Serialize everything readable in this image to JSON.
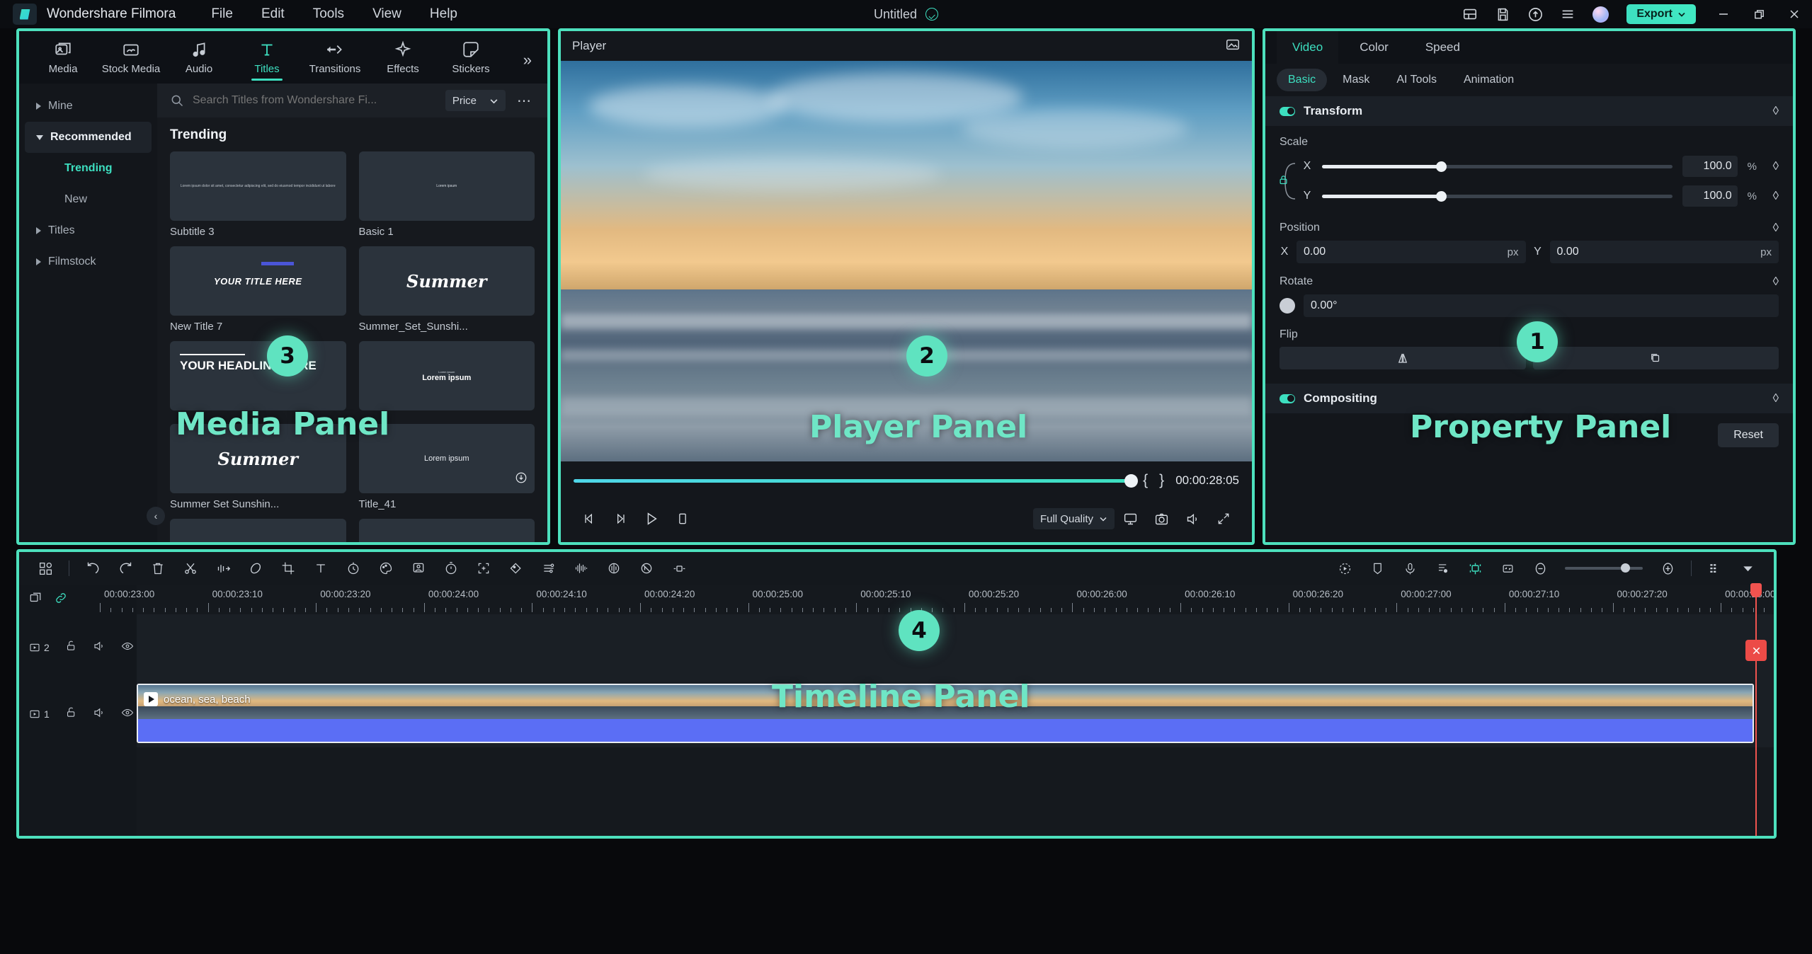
{
  "titlebar": {
    "app_name": "Wondershare Filmora",
    "menus": [
      "File",
      "Edit",
      "Tools",
      "View",
      "Help"
    ],
    "document_title": "Untitled",
    "saved_icon": "check-circle-icon",
    "right_icons": [
      "layout-icon",
      "save-icon",
      "cloud-upload-icon",
      "hamburger-menu-icon"
    ],
    "avatar": "user-avatar",
    "export_label": "Export",
    "window_controls": [
      "minimize",
      "restore",
      "close"
    ]
  },
  "media_panel": {
    "tabs": [
      {
        "label": "Media",
        "icon": "media-icon",
        "active": false
      },
      {
        "label": "Stock Media",
        "icon": "stock-media-icon",
        "active": false
      },
      {
        "label": "Audio",
        "icon": "audio-icon",
        "active": false
      },
      {
        "label": "Titles",
        "icon": "titles-icon",
        "active": true
      },
      {
        "label": "Transitions",
        "icon": "transitions-icon",
        "active": false
      },
      {
        "label": "Effects",
        "icon": "effects-icon",
        "active": false
      },
      {
        "label": "Stickers",
        "icon": "stickers-icon",
        "active": false
      }
    ],
    "more_tabs_icon": "chevron-double-right-icon",
    "categories": [
      {
        "label": "Mine",
        "type": "group",
        "expanded": false
      },
      {
        "label": "Recommended",
        "type": "group",
        "expanded": true
      },
      {
        "label": "Trending",
        "type": "sub",
        "active": true
      },
      {
        "label": "New",
        "type": "sub",
        "active": false
      },
      {
        "label": "Titles",
        "type": "group",
        "expanded": false
      },
      {
        "label": "Filmstock",
        "type": "group",
        "expanded": false
      }
    ],
    "collapse_icon": "chevron-left-icon",
    "search": {
      "placeholder": "Search Titles from Wondershare Fi...",
      "value": "",
      "icon": "search-icon"
    },
    "sort": {
      "label": "Price",
      "icon": "chevron-down-icon"
    },
    "more_options_icon": "more-horizontal-icon",
    "section_title": "Trending",
    "items": [
      {
        "name": "Subtitle 3",
        "preview_kind": "subtitle",
        "preview_text": "Lorem ipsum dolor sit amet, consectetur adipiscing elit, sed do eiusmod tempor incididunt ut labore"
      },
      {
        "name": "Basic 1",
        "preview_kind": "basic",
        "preview_text": "Lorem ipsum"
      },
      {
        "name": "New Title 7",
        "preview_kind": "title7",
        "preview_text": "YOUR TITLE HERE"
      },
      {
        "name": "Summer_Set_Sunshi...",
        "preview_kind": "script",
        "preview_text": "Summer"
      },
      {
        "name": "",
        "preview_kind": "headline",
        "preview_text": "YOUR HEADLINE HERE"
      },
      {
        "name": "",
        "preview_kind": "lorem-bold",
        "preview_text": "Lorem ipsum"
      },
      {
        "name": "Summer Set Sunshin...",
        "preview_kind": "script",
        "preview_text": "Summer"
      },
      {
        "name": "Title_41",
        "preview_kind": "lorem-plain",
        "preview_text": "Lorem ipsum",
        "download": true
      }
    ]
  },
  "player_panel": {
    "title": "Player",
    "snapshot_icon": "snapshot-icon",
    "timecode": "00:00:28:05",
    "mark_in": "{",
    "mark_out": "}",
    "progress_percent": 100,
    "controls": [
      {
        "name": "prev-frame-button",
        "icon": "prev-frame-icon"
      },
      {
        "name": "next-frame-button",
        "icon": "next-frame-icon"
      },
      {
        "name": "play-button",
        "icon": "play-icon"
      },
      {
        "name": "stop-button",
        "icon": "stop-icon"
      }
    ],
    "quality": {
      "label": "Full Quality",
      "icon": "chevron-down-icon"
    },
    "right_controls": [
      {
        "name": "display-settings-button",
        "icon": "monitor-icon"
      },
      {
        "name": "snapshot-button",
        "icon": "camera-icon"
      },
      {
        "name": "volume-button",
        "icon": "speaker-icon"
      },
      {
        "name": "fullscreen-button",
        "icon": "expand-icon"
      }
    ]
  },
  "property_panel": {
    "tabs": [
      {
        "label": "Video",
        "active": true
      },
      {
        "label": "Color",
        "active": false
      },
      {
        "label": "Speed",
        "active": false
      }
    ],
    "subtabs": [
      {
        "label": "Basic",
        "active": true
      },
      {
        "label": "Mask",
        "active": false
      },
      {
        "label": "AI Tools",
        "active": false
      },
      {
        "label": "Animation",
        "active": false
      }
    ],
    "transform": {
      "title": "Transform",
      "enabled": true,
      "keyframe_icon": "diamond-keyframe-icon",
      "scale_label": "Scale",
      "scale_x": {
        "axis": "X",
        "value": "100.0",
        "unit": "%"
      },
      "scale_y": {
        "axis": "Y",
        "value": "100.0",
        "unit": "%"
      },
      "lock_icon": "lock-icon",
      "position_label": "Position",
      "position_x": {
        "axis": "X",
        "value": "0.00",
        "unit": "px"
      },
      "position_y": {
        "axis": "Y",
        "value": "0.00",
        "unit": "px"
      },
      "rotate_label": "Rotate",
      "rotate_value": "0.00°",
      "flip_label": "Flip",
      "flip_horizontal_icon": "flip-horizontal-icon",
      "flip_vertical_icon": "flip-vertical-icon"
    },
    "compositing": {
      "title": "Compositing",
      "enabled": true,
      "keyframe_icon": "diamond-keyframe-icon"
    },
    "reset_label": "Reset"
  },
  "timeline": {
    "toolbar_left": [
      "project-media-icon",
      "undo-icon",
      "redo-icon",
      "delete-icon",
      "split-icon",
      "audio-detach-icon",
      "marker-icon",
      "crop-icon",
      "text-icon",
      "speed-icon",
      "color-icon",
      "green-screen-icon",
      "stopwatch-icon",
      "add-keyframe-icon",
      "mask-icon",
      "adjust-icon",
      "audio-waveform-icon",
      "audio-ducking-icon",
      "audio-sync-icon",
      "transition-icon"
    ],
    "toolbar_right": [
      "auto-reframe-icon",
      "marker-add-icon",
      "voiceover-icon",
      "auto-beat-icon",
      "green-screen-active-icon",
      "fit-timeline-icon",
      "zoom-out-icon",
      "zoom-in-icon",
      "grid-view-icon",
      "more-options-icon"
    ],
    "zoom_percent": 72,
    "ruler_labels": [
      "00:00:23:00",
      "00:00:23:10",
      "00:00:23:20",
      "00:00:24:00",
      "00:00:24:10",
      "00:00:24:20",
      "00:00:25:00",
      "00:00:25:10",
      "00:00:25:20",
      "00:00:26:00",
      "00:00:26:10",
      "00:00:26:20",
      "00:00:27:00",
      "00:00:27:10",
      "00:00:27:20",
      "00:00:28:00"
    ],
    "header_icons": [
      "mix-tracks-icon",
      "link-icon"
    ],
    "tracks": [
      {
        "number": "2",
        "type": "video",
        "lock_icon": "lock-open-icon",
        "mute_icon": "speaker-icon",
        "eye_icon": "eye-icon",
        "clips": []
      },
      {
        "number": "1",
        "type": "video",
        "lock_icon": "lock-open-icon",
        "mute_icon": "speaker-icon",
        "eye_icon": "eye-icon",
        "clips": [
          {
            "name": "ocean, sea, beach",
            "selected": true,
            "play_icon": "play-badge-icon"
          }
        ]
      }
    ],
    "playhead": {
      "position_label": "00:00:28:00",
      "badge_icon": "close-x-icon"
    }
  },
  "annotations": [
    {
      "number": "1",
      "label": "Property Panel"
    },
    {
      "number": "2",
      "label": "Player Panel"
    },
    {
      "number": "3",
      "label": "Media Panel"
    },
    {
      "number": "4",
      "label": "Timeline Panel"
    }
  ],
  "colors": {
    "accent": "#3ddfc0",
    "highlight_border": "#4de0bd",
    "callout": "#5fe3c0",
    "playhead": "#f0534f",
    "audio_clip": "#5b6ef5",
    "background": "#12151a"
  }
}
